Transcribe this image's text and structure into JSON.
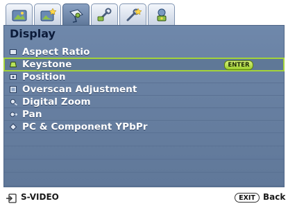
{
  "tabs": [
    {
      "icon": "picture-icon",
      "active": false
    },
    {
      "icon": "picture-advanced-icon",
      "active": false
    },
    {
      "icon": "display-icon",
      "active": true
    },
    {
      "icon": "setup-basic-icon",
      "active": false
    },
    {
      "icon": "setup-advanced-icon",
      "active": false
    },
    {
      "icon": "information-icon",
      "active": false
    }
  ],
  "panel": {
    "title": "Display",
    "items": [
      {
        "label": "Aspect Ratio",
        "icon": "aspect-ratio-icon",
        "selected": false
      },
      {
        "label": "Keystone",
        "icon": "keystone-icon",
        "selected": true
      },
      {
        "label": "Position",
        "icon": "position-icon",
        "selected": false
      },
      {
        "label": "Overscan Adjustment",
        "icon": "overscan-icon",
        "selected": false
      },
      {
        "label": "Digital Zoom",
        "icon": "digital-zoom-icon",
        "selected": false
      },
      {
        "label": "Pan",
        "icon": "pan-icon",
        "selected": false
      },
      {
        "label": "PC & Component YPbPr",
        "icon": "pc-component-icon",
        "selected": false
      }
    ],
    "enter_label": "ENTER"
  },
  "footer": {
    "source_label": "S-VIDEO",
    "exit_label": "EXIT",
    "back_label": "Back"
  },
  "colors": {
    "panel_bg": "#6a82a4",
    "selection_outline": "#a3d33a",
    "title": "#0c1b3a"
  }
}
